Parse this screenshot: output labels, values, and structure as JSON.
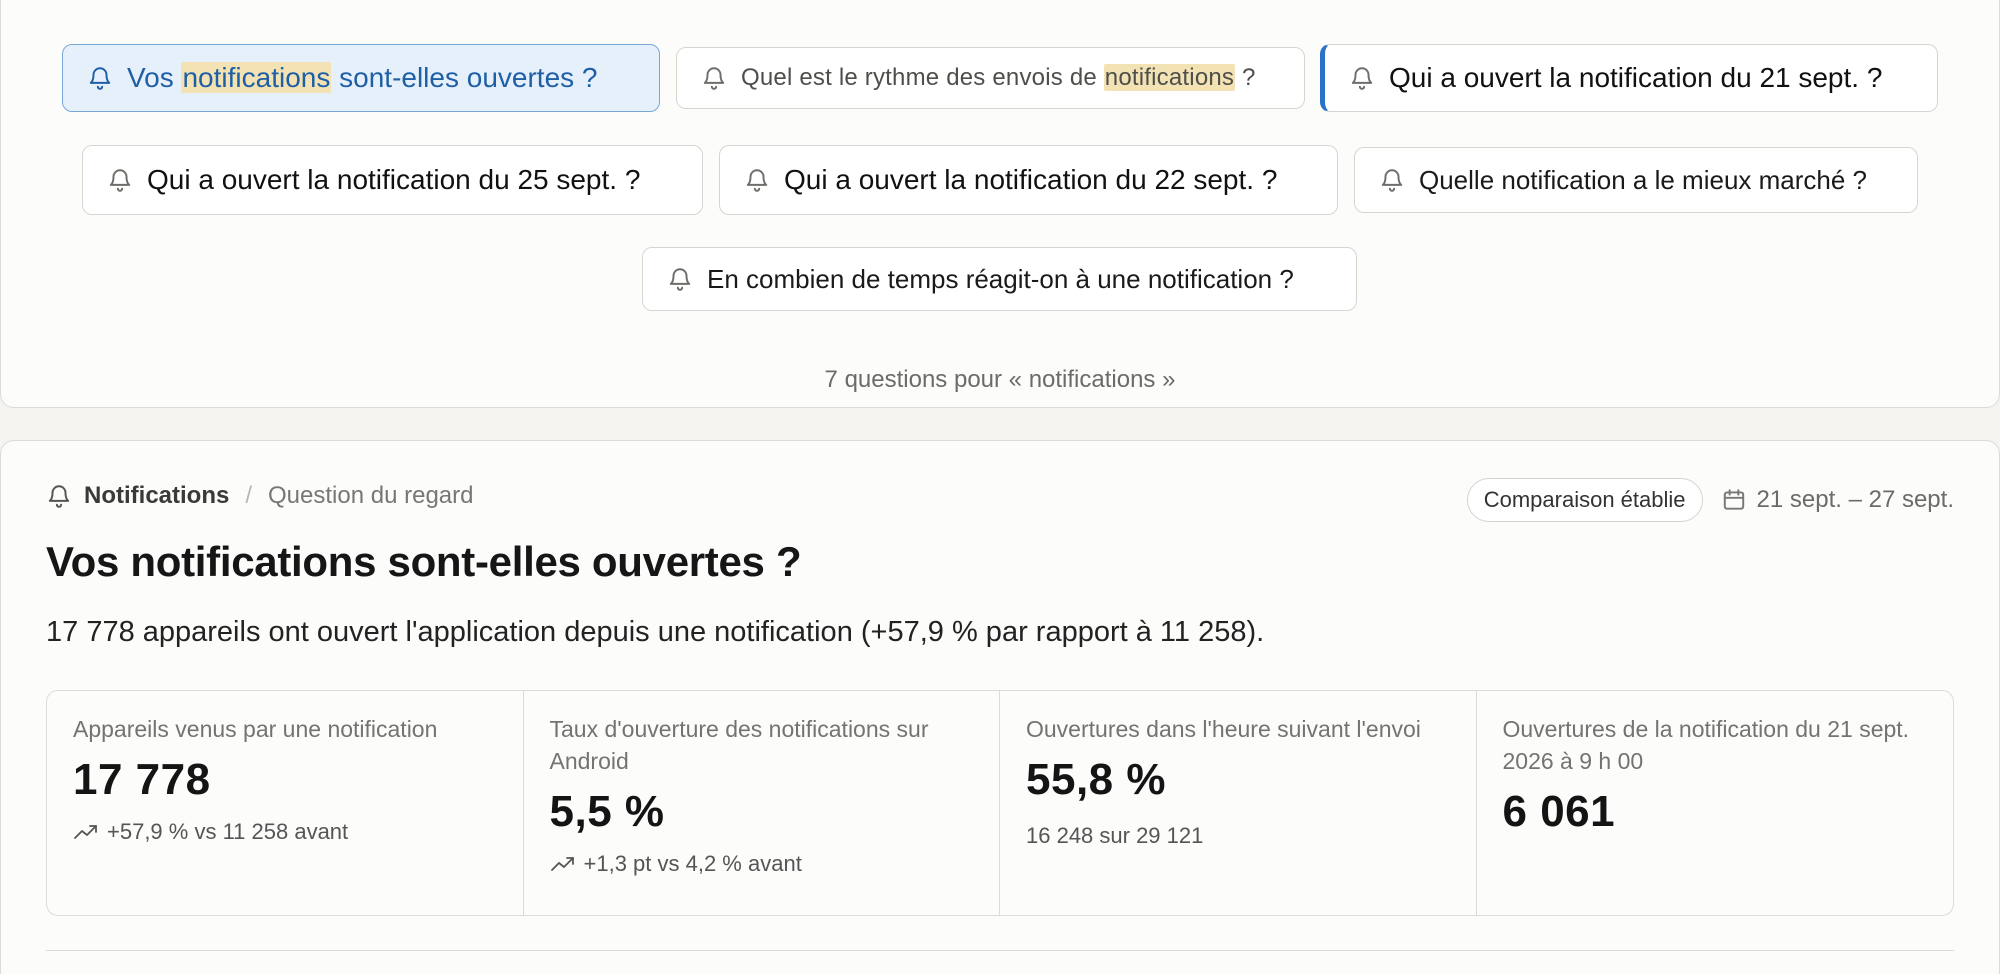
{
  "questions": [
    {
      "pre": "Vos ",
      "hl": "notifications",
      "post": " sont-elles ouvertes ?"
    },
    {
      "pre": "Quel est le rythme des envois de ",
      "hl": "notifications",
      "post": " ?"
    },
    {
      "text": "Qui a ouvert la notification du 21 sept. ?"
    },
    {
      "text": "Qui a ouvert la notification du 25 sept. ?"
    },
    {
      "text": "Qui a ouvert la notification du 22 sept. ?"
    },
    {
      "text": "Quelle notification a le mieux marché ?"
    },
    {
      "text": "En combien de temps réagit-on à une notification ?"
    }
  ],
  "question_count": "7 questions pour « notifications »",
  "breadcrumb": {
    "main": "Notifications",
    "sep": "/",
    "sub": "Question du regard"
  },
  "badge": "Comparaison établie",
  "date_range": "21 sept. – 27 sept.",
  "title": "Vos notifications sont-elles ouvertes ?",
  "summary": "17 778 appareils ont ouvert l'application depuis une notification (+57,9 % par rapport à 11 258).",
  "kpis": [
    {
      "label": "Appareils venus par une notification",
      "value": "17 778",
      "delta": "+57,9 % vs 11 258 avant"
    },
    {
      "label": "Taux d'ouverture des notifications sur Android",
      "value": "5,5 %",
      "delta": "+1,3 pt vs 4,2 % avant"
    },
    {
      "label": "Ouvertures dans l'heure suivant l'envoi",
      "value": "55,8 %",
      "sub": "16 248 sur 29 121"
    },
    {
      "label": "Ouvertures de la notification du 21 sept. 2026 à 9 h 00",
      "value": "6 061"
    }
  ],
  "colors": {
    "accent": "#2a72c9",
    "active_bg": "#e6f0fb",
    "highlight": "#f3e3b4"
  }
}
